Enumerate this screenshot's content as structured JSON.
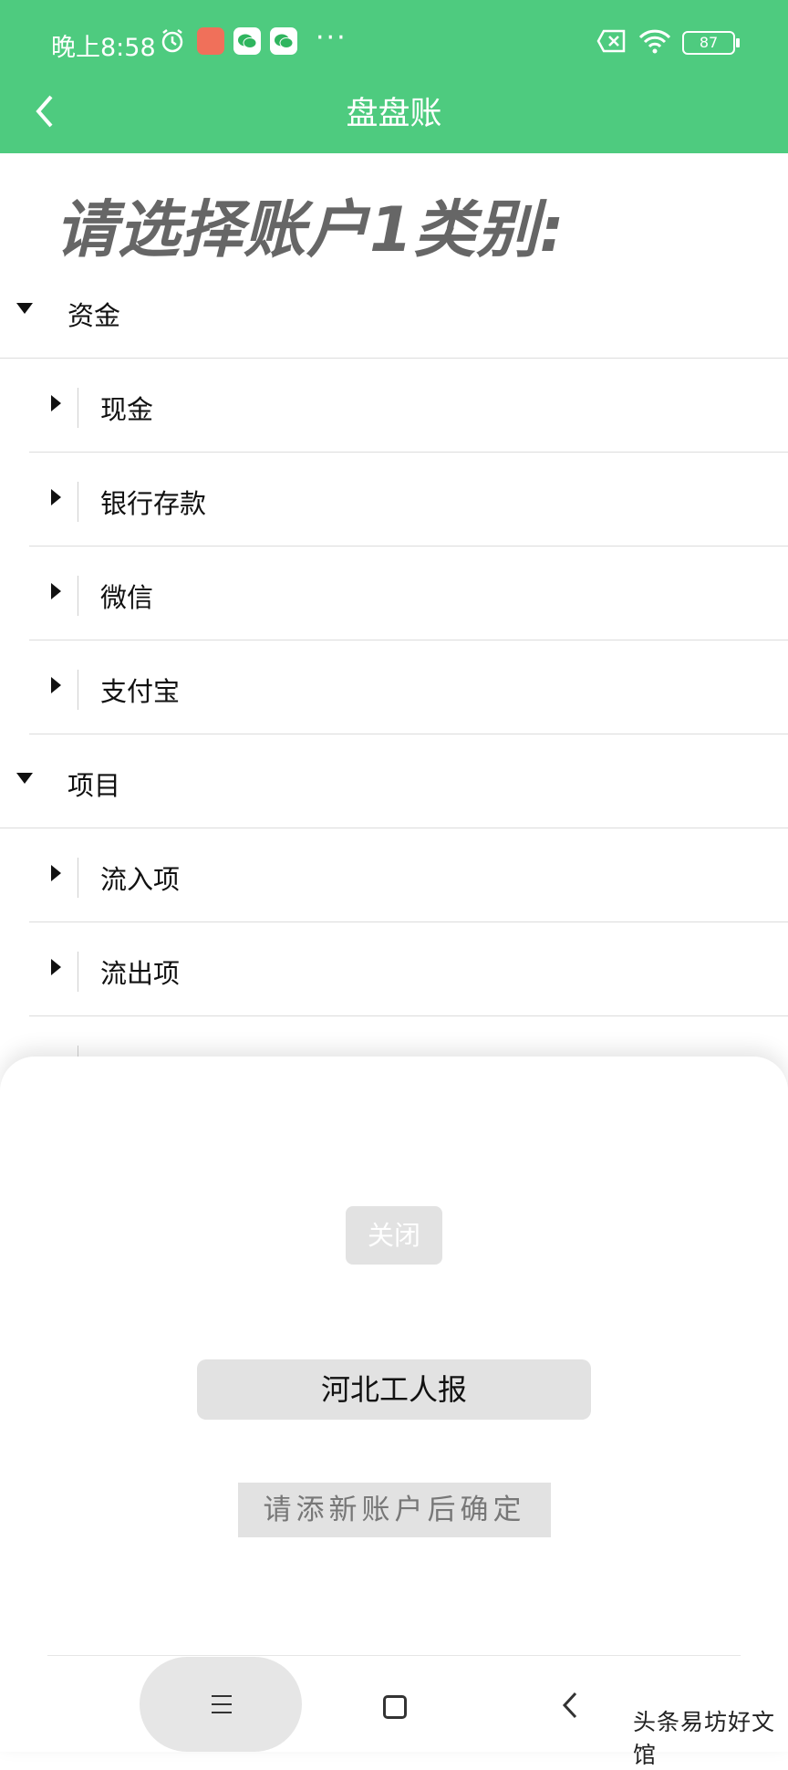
{
  "status_bar": {
    "time": "晚上8:58",
    "battery": "87",
    "more_dots": "···",
    "icons": [
      "alarm-clock-icon",
      "red-app-icon",
      "wechat-icon",
      "wechat-icon",
      "sim-icon",
      "wifi-icon",
      "battery-icon"
    ]
  },
  "header": {
    "title": "盘盘账"
  },
  "page": {
    "heading": "请选择账户1类别:"
  },
  "tree": [
    {
      "label": "资金",
      "level": "parent"
    },
    {
      "label": "现金",
      "level": "child"
    },
    {
      "label": "银行存款",
      "level": "child"
    },
    {
      "label": "微信",
      "level": "child"
    },
    {
      "label": "支付宝",
      "level": "child"
    },
    {
      "label": "项目",
      "level": "parent"
    },
    {
      "label": "流入项",
      "level": "child"
    },
    {
      "label": "流出项",
      "level": "child"
    }
  ],
  "sheet": {
    "close_label": "关闭",
    "account_name": "河北工人报",
    "confirm_label": "请添新账户后确定"
  },
  "watermark": "头条易坊好文馆",
  "colors": {
    "accent": "#4ecb7f",
    "button_bg": "#e2e2e2"
  }
}
